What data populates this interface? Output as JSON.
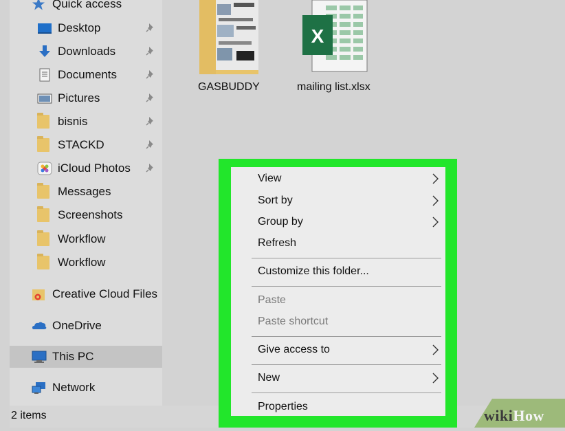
{
  "nav": {
    "quick_access": "Quick access",
    "items": [
      {
        "label": "Desktop",
        "icon": "desktop-icon",
        "pinned": true
      },
      {
        "label": "Downloads",
        "icon": "downloads-icon",
        "pinned": true
      },
      {
        "label": "Documents",
        "icon": "documents-icon",
        "pinned": true
      },
      {
        "label": "Pictures",
        "icon": "pictures-icon",
        "pinned": true
      },
      {
        "label": "bisnis",
        "icon": "folder-icon",
        "pinned": true
      },
      {
        "label": "STACKD",
        "icon": "folder-icon",
        "pinned": true
      },
      {
        "label": "iCloud Photos",
        "icon": "icloud-photos-icon",
        "pinned": true
      },
      {
        "label": "Messages",
        "icon": "folder-icon",
        "pinned": false
      },
      {
        "label": "Screenshots",
        "icon": "folder-icon",
        "pinned": false
      },
      {
        "label": "Workflow",
        "icon": "folder-icon",
        "pinned": false
      },
      {
        "label": "Workflow",
        "icon": "folder-icon",
        "pinned": false
      }
    ],
    "creative_cloud": "Creative Cloud Files",
    "onedrive": "OneDrive",
    "this_pc": "This PC",
    "network": "Network"
  },
  "files": [
    {
      "label": "GASBUDDY",
      "icon": "folder-with-thumbnail-icon"
    },
    {
      "label": "mailing list.xlsx",
      "icon": "excel-file-icon"
    }
  ],
  "status": {
    "items": "2 items"
  },
  "context_menu": {
    "view": "View",
    "sort_by": "Sort by",
    "group_by": "Group by",
    "refresh": "Refresh",
    "customize": "Customize this folder...",
    "paste": "Paste",
    "paste_shortcut": "Paste shortcut",
    "give_access": "Give access to",
    "new": "New",
    "properties": "Properties"
  },
  "watermark": {
    "wiki": "wiki",
    "how": "How"
  },
  "colors": {
    "highlight": "#22e62b",
    "excel_green": "#1e7145",
    "menu_bg": "#ececec"
  }
}
